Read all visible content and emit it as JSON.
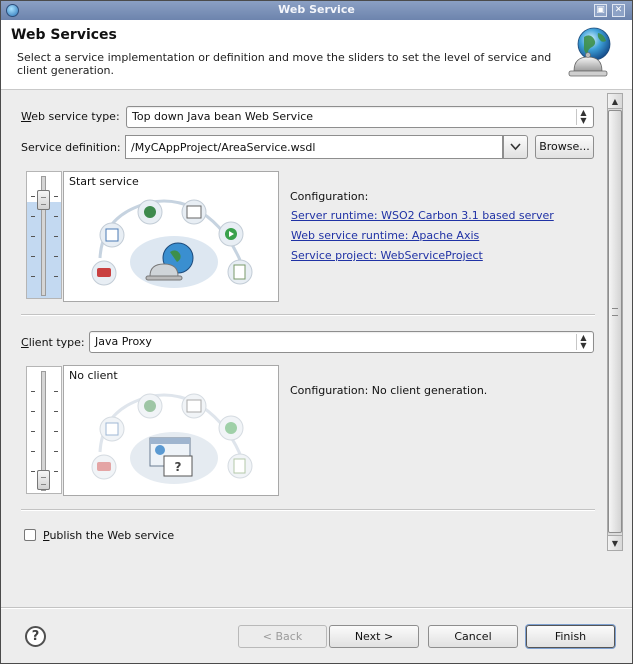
{
  "window": {
    "title": "Web Service",
    "controls": [
      "restore-icon",
      "close-icon"
    ]
  },
  "header": {
    "title": "Web Services",
    "description": "Select a service implementation or definition and move the sliders to set the level of service and client generation.",
    "icon": "web-service-globe-bell-icon"
  },
  "service": {
    "type_label_mnemonic": "W",
    "type_label_rest": "eb service type:",
    "type_value": "Top down Java bean Web Service",
    "definition_label": "Service definition:",
    "definition_value": "/MyCAppProject/AreaService.wsdl",
    "browse_label": "Browse...",
    "slider_state": "Start service",
    "configuration_label": "Configuration:",
    "links": [
      "Server runtime: WSO2 Carbon 3.1 based server",
      "Web service runtime: Apache Axis",
      "Service project: WebServiceProject"
    ]
  },
  "client": {
    "type_label_mnemonic": "C",
    "type_label_rest": "lient type:",
    "type_value": "Java Proxy",
    "slider_state": "No client",
    "configuration_text": "Configuration: No client generation."
  },
  "publish": {
    "checked": false,
    "label_mnemonic": "P",
    "label_rest": "ublish the Web service"
  },
  "footer": {
    "help_glyph": "?",
    "back_label": "< Back",
    "next_label": "Next >",
    "cancel_label": "Cancel",
    "finish_label": "Finish"
  },
  "colors": {
    "titlebar": "#7088b0",
    "link": "#2032a5",
    "background": "#ededed",
    "slider_fill": "#c3d9f1"
  }
}
